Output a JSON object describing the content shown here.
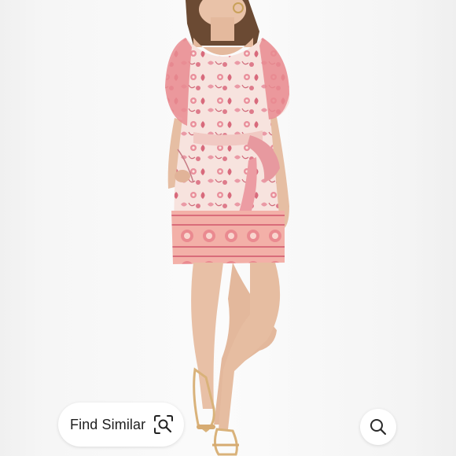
{
  "find_similar": {
    "label": "Find Similar",
    "icon": "visual-search-icon"
  },
  "search_button": {
    "icon": "search-icon"
  },
  "colors": {
    "background": "#f6f6f6",
    "dress_base": "#f7e1dc",
    "dress_print": "#e07a8a",
    "dress_border": "#ec8f8f",
    "skin": "#e8c0a6",
    "hair": "#6b4a33"
  }
}
